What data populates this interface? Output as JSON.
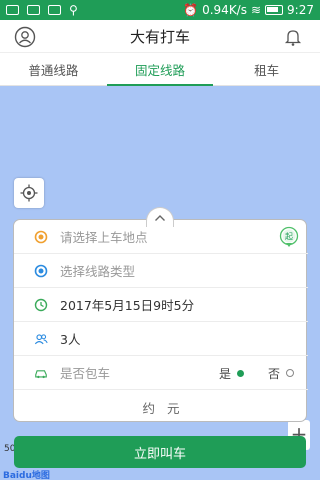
{
  "status_bar": {
    "network_speed": "0.94K/s",
    "time": "9:27"
  },
  "header": {
    "title": "大有打车",
    "profile_icon": "profile-icon",
    "bell_icon": "bell-icon"
  },
  "tabs": [
    {
      "label": "普通线路",
      "active": false
    },
    {
      "label": "固定线路",
      "active": true
    },
    {
      "label": "租车",
      "active": false
    }
  ],
  "form": {
    "pickup_placeholder": "请选择上车地点",
    "pickup_pin_label": "起",
    "route_placeholder": "选择线路类型",
    "datetime_value": "2017年5月15日9时5分",
    "passengers_value": "3人",
    "charter_label": "是否包车",
    "charter_yes": "是",
    "charter_no": "否",
    "charter_selected": "是",
    "price_text": "约   元"
  },
  "map": {
    "scale_text": "50",
    "logo_text_a": "Bai",
    "logo_text_b": "du地图"
  },
  "call_button_label": "立即叫车",
  "colors": {
    "accent": "#1f9d57",
    "map_bg": "#a9c5f5",
    "pickup_icon": "#f0a030",
    "route_icon": "#2b8be0"
  }
}
